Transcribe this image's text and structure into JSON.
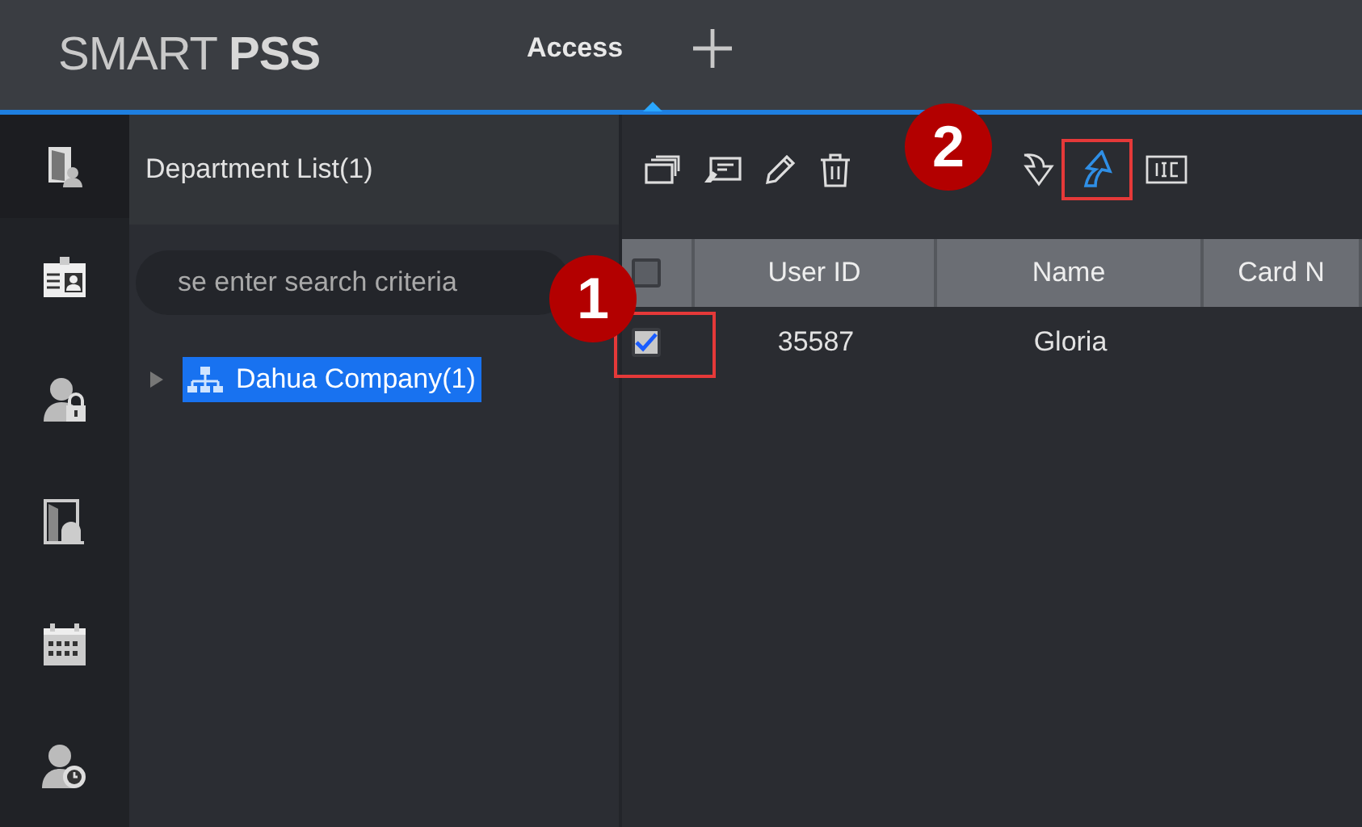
{
  "app": {
    "logo_light": "SMART",
    "logo_bold": "PSS"
  },
  "tabs": [
    {
      "label": "Access",
      "selected": true
    }
  ],
  "department_panel": {
    "title": "Department List(1)",
    "search": {
      "placeholder": "se enter search criteria"
    },
    "tree": [
      {
        "label": "Dahua Company(1)",
        "selected": true,
        "expanded": false
      }
    ]
  },
  "table": {
    "header_checked": false,
    "columns": [
      "User ID",
      "Name",
      "Card N"
    ],
    "rows": [
      {
        "checked": true,
        "cells": [
          "35587",
          "Gloria"
        ]
      }
    ]
  },
  "callouts": [
    {
      "label": "1"
    },
    {
      "label": "2"
    }
  ]
}
